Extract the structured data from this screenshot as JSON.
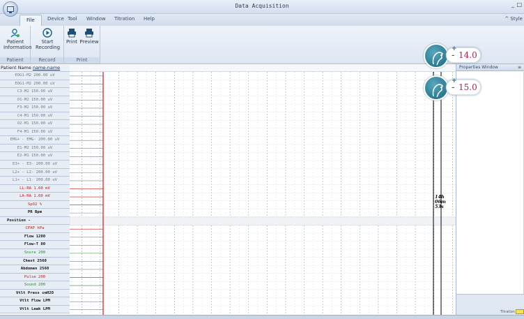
{
  "window": {
    "title": "Data Acquisition",
    "minimize": "_",
    "restore": "□"
  },
  "tabs": [
    {
      "label": "File",
      "active": true
    },
    {
      "label": "Device"
    },
    {
      "label": "Tool"
    },
    {
      "label": "Window"
    },
    {
      "label": "Titration"
    },
    {
      "label": "Help"
    }
  ],
  "style_link": "^ Style",
  "ribbon": {
    "patient_info": "Patient Information",
    "start_recording": "Start Recording",
    "print": "Print",
    "preview": "Preview",
    "group_patient": "Patient",
    "group_record": "Record",
    "group_print": "Print"
  },
  "patient": {
    "label": "Patient Name",
    "value": "name-name"
  },
  "channels": [
    {
      "label": "EOG1-M2  200.00 uV",
      "style": "gray"
    },
    {
      "label": "EOG1-M2  200.00 uV",
      "style": "gray"
    },
    {
      "label": "C3-M2  150.00 uV",
      "style": "gray"
    },
    {
      "label": "O1-M2  150.00 uV",
      "style": "gray"
    },
    {
      "label": "F3-M2  150.00 uV",
      "style": "gray"
    },
    {
      "label": "C4-M1  150.00 uV",
      "style": "gray"
    },
    {
      "label": "O2-M1  150.00 uV",
      "style": "gray"
    },
    {
      "label": "F4-M1  150.00 uV",
      "style": "gray"
    },
    {
      "label": "EMG+ - EMG-  200.00 uV",
      "style": "gray"
    },
    {
      "label": "E1-M2  150.00 uV",
      "style": "gray"
    },
    {
      "label": "E2-M1  150.00 uV",
      "style": "gray"
    },
    {
      "label": "E3+ - E3-  200.00 uV",
      "style": "gray"
    },
    {
      "label": "L2+ - L2-  200.00 uV",
      "style": "gray"
    },
    {
      "label": "L1+ - L1-  200.00 uV",
      "style": "gray"
    },
    {
      "label": "LL-RA  1.60 mV",
      "style": "red"
    },
    {
      "label": "LA-RA  1.60 mV",
      "style": "red"
    },
    {
      "label": "SpO2  %",
      "style": "red"
    },
    {
      "label": "PR  Bpm",
      "style": "dark"
    },
    {
      "label": "Position  -",
      "style": "pos"
    },
    {
      "label": "CPAP  hPa",
      "style": "red"
    },
    {
      "label": "Flow  1280",
      "style": "dark"
    },
    {
      "label": "Flow-T  80",
      "style": "dark"
    },
    {
      "label": "Snore  200",
      "style": "green"
    },
    {
      "label": "Chest  2560",
      "style": "dark"
    },
    {
      "label": "Abdomen  2560",
      "style": "dark"
    },
    {
      "label": "Pulse  200",
      "style": "red"
    },
    {
      "label": "Sound  200",
      "style": "green"
    },
    {
      "label": "Vtlt Press  cmH2O",
      "style": "dark"
    },
    {
      "label": "Vtlt Flow  LPM",
      "style": "dark"
    },
    {
      "label": "Vtlt Leak  LPM",
      "style": "dark"
    }
  ],
  "properties": {
    "title": "Properties Window",
    "pin": "≡"
  },
  "zoom_controls": [
    {
      "value": "14.0",
      "plus": "+",
      "minus": "–"
    },
    {
      "value": "15.0",
      "plus": "+",
      "minus": "–"
    }
  ],
  "cursor_time": {
    "hours": "14h",
    "minutes": "06m",
    "seconds": "53s"
  },
  "status": {
    "label": "Titration",
    "color": "#f5e25a"
  },
  "colors": {
    "accent": "#1a6f86",
    "red_channel": "#c41a1a",
    "green_channel": "#2a8a34",
    "value_text": "#a0264c"
  }
}
